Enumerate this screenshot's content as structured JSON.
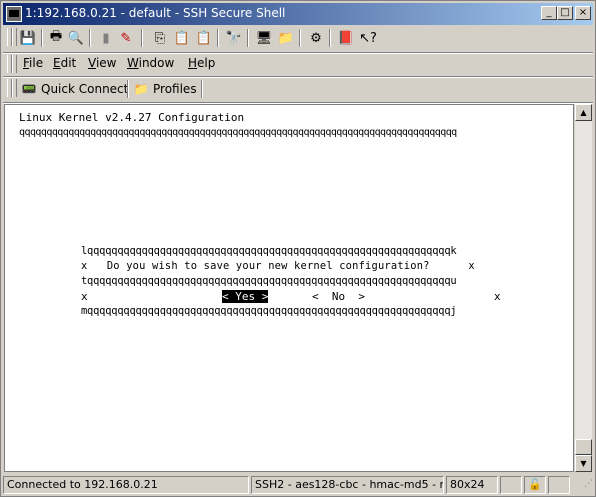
{
  "window": {
    "title": "1:192.168.0.21 - default - SSH Secure Shell"
  },
  "title_buttons": {
    "minimize": "_",
    "maximize": "□",
    "close": "×"
  },
  "menus": [
    "File",
    "Edit",
    "View",
    "Window",
    "Help"
  ],
  "quick_bar": {
    "quick_connect": "Quick Connect",
    "profiles": "Profiles"
  },
  "terminal": {
    "lines": [
      "Linux Kernel v2.4.27 Configuration",
      "qqqqqqqqqqqqqqqqqqqqqqqqqqqqqqqqqqqqqqqqqqqqqqqqqqqqqqqqqqqqqqqqqqqqqqqqqqqqqqqq",
      "lqqqqqqqqqqqqqqqqqqqqqqqqqqqqqqqqqqqqqqqqqqqqqqqqqqqqqqqqqqqqk",
      "x   Do you wish to save your new kernel configuration?      x",
      "tqqqqqqqqqqqqqqqqqqqqqqqqqqqqqqqqqqqqqqqqqqqqqqqqqqqqqqqqqqqqu",
      "x",
      "x",
      "mqqqqqqqqqqqqqqqqqqqqqqqqqqqqqqqqqqqqqqqqqqqqqqqqqqqqqqqqqqqqj"
    ],
    "yes_button": "< Yes >",
    "no_button": "<  No  >"
  },
  "status": {
    "connection": "Connected to 192.168.0.21",
    "cipher": "SSH2 - aes128-cbc - hmac-md5 - r",
    "size": "80x24"
  }
}
